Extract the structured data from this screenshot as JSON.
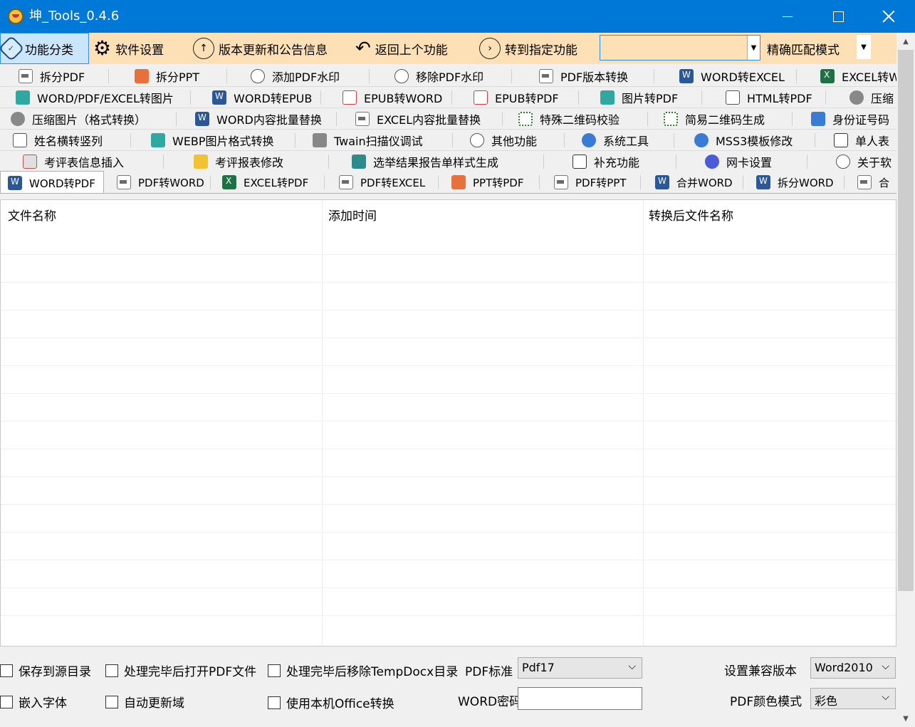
{
  "window": {
    "title": "坤_Tools_0.4.6",
    "accent": "#0078d7"
  },
  "toolbar": {
    "items": [
      {
        "label": "功能分类",
        "icon": "category-icon"
      },
      {
        "label": "软件设置",
        "icon": "gear-icon"
      },
      {
        "label": "版本更新和公告信息",
        "icon": "arrow-up-circle-icon"
      },
      {
        "label": "返回上个功能",
        "icon": "back-arrow-icon"
      },
      {
        "label": "转到指定功能",
        "icon": "arrow-right-circle-icon"
      }
    ],
    "search_value": "",
    "match_mode": "精确匹配模式",
    "background": "#fde0b6"
  },
  "tab_rows": [
    [
      {
        "label": "拆分PDF",
        "icon": "pdf-icon"
      },
      {
        "label": "拆分PPT",
        "icon": "ppt-icon"
      },
      {
        "label": "添加PDF水印",
        "icon": "watermark-icon"
      },
      {
        "label": "移除PDF水印",
        "icon": "watermark-icon"
      },
      {
        "label": "PDF版本转换",
        "icon": "pdf-icon"
      },
      {
        "label": "WORD转EXCEL",
        "icon": "word-icon"
      },
      {
        "label": "EXCEL转W",
        "icon": "excel-icon"
      }
    ],
    [
      {
        "label": "WORD/PDF/EXCEL转图片",
        "icon": "image-icon"
      },
      {
        "label": "WORD转EPUB",
        "icon": "word-icon"
      },
      {
        "label": "EPUB转WORD",
        "icon": "epub-icon"
      },
      {
        "label": "EPUB转PDF",
        "icon": "epub-icon"
      },
      {
        "label": "图片转PDF",
        "icon": "image-icon"
      },
      {
        "label": "HTML转PDF",
        "icon": "html-icon"
      },
      {
        "label": "压缩",
        "icon": "compress-icon"
      }
    ],
    [
      {
        "label": "压缩图片（格式转换）",
        "icon": "compress-icon"
      },
      {
        "label": "WORD内容批量替换",
        "icon": "word-icon"
      },
      {
        "label": "EXCEL内容批量替换",
        "icon": "pdf-icon"
      },
      {
        "label": "特殊二维码校验",
        "icon": "qr-code-icon"
      },
      {
        "label": "简易二维码生成",
        "icon": "qr-code-icon"
      },
      {
        "label": "身份证号码",
        "icon": "id-card-icon"
      }
    ],
    [
      {
        "label": "姓名横转竖列",
        "icon": "name-list-icon"
      },
      {
        "label": "WEBP图片格式转换",
        "icon": "image-icon"
      },
      {
        "label": "Twain扫描仪调试",
        "icon": "scanner-icon"
      },
      {
        "label": "其他功能",
        "icon": "more-icon"
      },
      {
        "label": "系统工具",
        "icon": "gear-icon"
      },
      {
        "label": "MSS3模板修改",
        "icon": "gear-icon"
      },
      {
        "label": "单人表",
        "icon": "document-icon"
      }
    ],
    [
      {
        "label": "考评表信息插入",
        "icon": "form-icon"
      },
      {
        "label": "考评报表修改",
        "icon": "edit-icon"
      },
      {
        "label": "选举结果报告单样式生成",
        "icon": "report-icon"
      },
      {
        "label": "补充功能",
        "icon": "document-icon"
      },
      {
        "label": "网卡设置",
        "icon": "network-card-icon"
      },
      {
        "label": "关于软",
        "icon": "info-icon"
      }
    ]
  ],
  "sub_tabs": [
    {
      "label": "WORD转PDF",
      "icon": "word-icon",
      "active": true
    },
    {
      "label": "PDF转WORD",
      "icon": "pdf-icon"
    },
    {
      "label": "EXCEL转PDF",
      "icon": "excel-icon"
    },
    {
      "label": "PDF转EXCEL",
      "icon": "pdf-icon"
    },
    {
      "label": "PPT转PDF",
      "icon": "ppt-icon"
    },
    {
      "label": "PDF转PPT",
      "icon": "pdf-icon"
    },
    {
      "label": "合并WORD",
      "icon": "word-icon"
    },
    {
      "label": "拆分WORD",
      "icon": "word-icon"
    },
    {
      "label": "合",
      "icon": "pdf-icon"
    }
  ],
  "table": {
    "columns": [
      "文件名称",
      "添加时间",
      "转换后文件名称"
    ],
    "rows": []
  },
  "options": {
    "save_to_source": "保存到源目录",
    "open_pdf_after": "处理完毕后打开PDF文件",
    "remove_temp_after": "处理完毕后移除TempDocx目录",
    "pdf_standard_label": "PDF标准",
    "pdf_standard_value": "Pdf17",
    "compat_version_label": "设置兼容版本",
    "compat_version_value": "Word2010",
    "embed_fonts": "嵌入字体",
    "auto_update_fields": "自动更新域",
    "use_local_office": "使用本机Office转换",
    "word_password_label": "WORD密码",
    "word_password_value": "",
    "pdf_color_label": "PDF颜色模式",
    "pdf_color_value": "彩色"
  }
}
